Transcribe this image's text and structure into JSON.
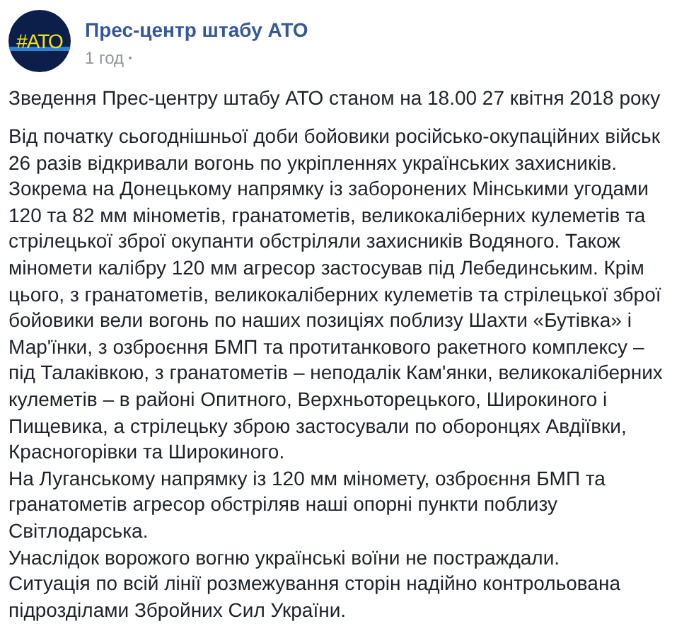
{
  "post": {
    "avatar_text": "#АТО",
    "author": "Прес-центр штабу АТО",
    "time": "1 год",
    "title": "Зведення Прес-центру штабу АТО станом на 18.00 27 квітня 2018 року",
    "paragraphs": [
      "Від початку сьогоднішньої доби бойовики російсько-окупаційних військ 26 разів відкривали вогонь по укріпленнях українських захисників. Зокрема на Донецькому напрямку із заборонених Мінськими угодами 120 та 82 мм мінометів, гранатометів, великокаліберних кулеметів та стрілецької зброї окупанти обстріляли захисників Водяного. Також міномети калібру 120 мм агресор застосував під Лебединським. Крім цього, з гранатометів, великокаліберних кулеметів та стрілецької зброї бойовики вели вогонь по наших позиціях поблизу Шахти «Бутівка» і Мар'їнки, з озброєння БМП та протитанкового ракетного комплексу – під Талаківкою, з гранатометів – неподалік Кам'янки, великокаліберних кулеметів – в районі Опитного, Верхньоторецького, Широкиного і Пищевика, а стрілецьку зброю застосували по оборонцях Авдіївки, Красногорівки та Широкиного.",
      "На Луганському напрямку із 120 мм міномету, озброєння БМП та гранатометів агресор обстріляв наші опорні пункти поблизу Світлодарська.",
      "Унаслідок ворожого вогню українські воїни не постраждали.",
      "Ситуація по всій лінії розмежування сторін надійно контрольована підрозділами Збройних Сил України."
    ]
  }
}
